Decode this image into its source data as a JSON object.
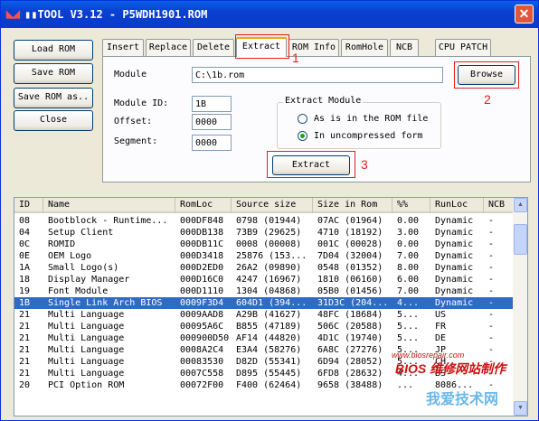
{
  "window": {
    "title": "TOOL V3.12 - P5WDH1901.ROM",
    "title_prefix": "▮▮"
  },
  "side_buttons": {
    "load": "Load ROM",
    "save": "Save ROM",
    "save_as": "Save ROM as..",
    "close": "Close"
  },
  "tabs": [
    "Insert",
    "Replace",
    "Delete",
    "Extract",
    "ROM Info",
    "RomHole",
    "NCB",
    "CPU PATCH"
  ],
  "active_tab": "Extract",
  "extract": {
    "module_label": "Module",
    "module_value": "C:\\1b.rom",
    "browse": "Browse",
    "module_id_label": "Module ID:",
    "module_id_value": "1B",
    "offset_label": "Offset:",
    "offset_value": "0000",
    "segment_label": "Segment:",
    "segment_value": "0000",
    "group_title": "Extract Module",
    "option1": "As is in the ROM file",
    "option2": "In uncompressed form",
    "selected_option": "In uncompressed form",
    "extract_button": "Extract"
  },
  "annotations": [
    "1",
    "2",
    "3"
  ],
  "table": {
    "columns": [
      "ID",
      "Name",
      "RomLoc",
      "Source size",
      "Size in Rom",
      "%%",
      "RunLoc",
      "NCB"
    ],
    "rows": [
      [
        "08",
        "Bootblock - Runtime...",
        "000DF848",
        "0798 (01944)",
        "07AC (01964)",
        "0.00",
        "Dynamic",
        "-"
      ],
      [
        "04",
        "Setup Client",
        "000DB138",
        "73B9 (29625)",
        "4710 (18192)",
        "3.00",
        "Dynamic",
        "-"
      ],
      [
        "0C",
        "ROMID",
        "000DB11C",
        "0008 (00008)",
        "001C (00028)",
        "0.00",
        "Dynamic",
        "-"
      ],
      [
        "0E",
        "OEM Logo",
        "000D3418",
        "25876 (153...",
        "7D04 (32004)",
        "7.00",
        "Dynamic",
        "-"
      ],
      [
        "1A",
        "Small Logo(s)",
        "000D2ED0",
        "26A2 (09890)",
        "0548 (01352)",
        "8.00",
        "Dynamic",
        "-"
      ],
      [
        "18",
        "Display Manager",
        "000D16C0",
        "4247 (16967)",
        "1810 (06160)",
        "6.00",
        "Dynamic",
        "-"
      ],
      [
        "19",
        "Font Module",
        "000D1110",
        "1304 (04868)",
        "05B0 (01456)",
        "7.00",
        "Dynamic",
        "-"
      ],
      [
        "1B",
        "Single Link Arch BIOS",
        "0009F3D4",
        "604D1 (394...",
        "31D3C (204...",
        "4...",
        "Dynamic",
        "-"
      ],
      [
        "21",
        "Multi Language",
        "0009AAD8",
        "A29B (41627)",
        "48FC (18684)",
        "5...",
        "US",
        "-"
      ],
      [
        "21",
        "Multi Language",
        "00095A6C",
        "B855 (47189)",
        "506C (20588)",
        "5...",
        "FR",
        "-"
      ],
      [
        "21",
        "Multi Language",
        "000900D50",
        "AF14 (44820)",
        "4D1C (19740)",
        "5...",
        "DE",
        "-"
      ],
      [
        "21",
        "Multi Language",
        "0008A2C4",
        "E3A4 (58276)",
        "6A8C (27276)",
        "5...",
        "JP",
        "-"
      ],
      [
        "21",
        "Multi Language",
        "00083530",
        "D82D (55341)",
        "6D94 (28052)",
        "5...",
        "CH",
        "-"
      ],
      [
        "21",
        "Multi Language",
        "0007C558",
        "D895 (55445)",
        "6FD8 (28632)",
        "4...",
        "BS",
        "-"
      ],
      [
        "20",
        "PCI Option ROM",
        "00072F00",
        "F400 (62464)",
        "9658 (38488)",
        "...",
        "8086...",
        "-"
      ]
    ],
    "selected_row_index": 7
  },
  "watermark": {
    "line1": "www.biosrepair.com",
    "line2": "BIOS 维修网站制作",
    "line3": "我爱技术网"
  }
}
